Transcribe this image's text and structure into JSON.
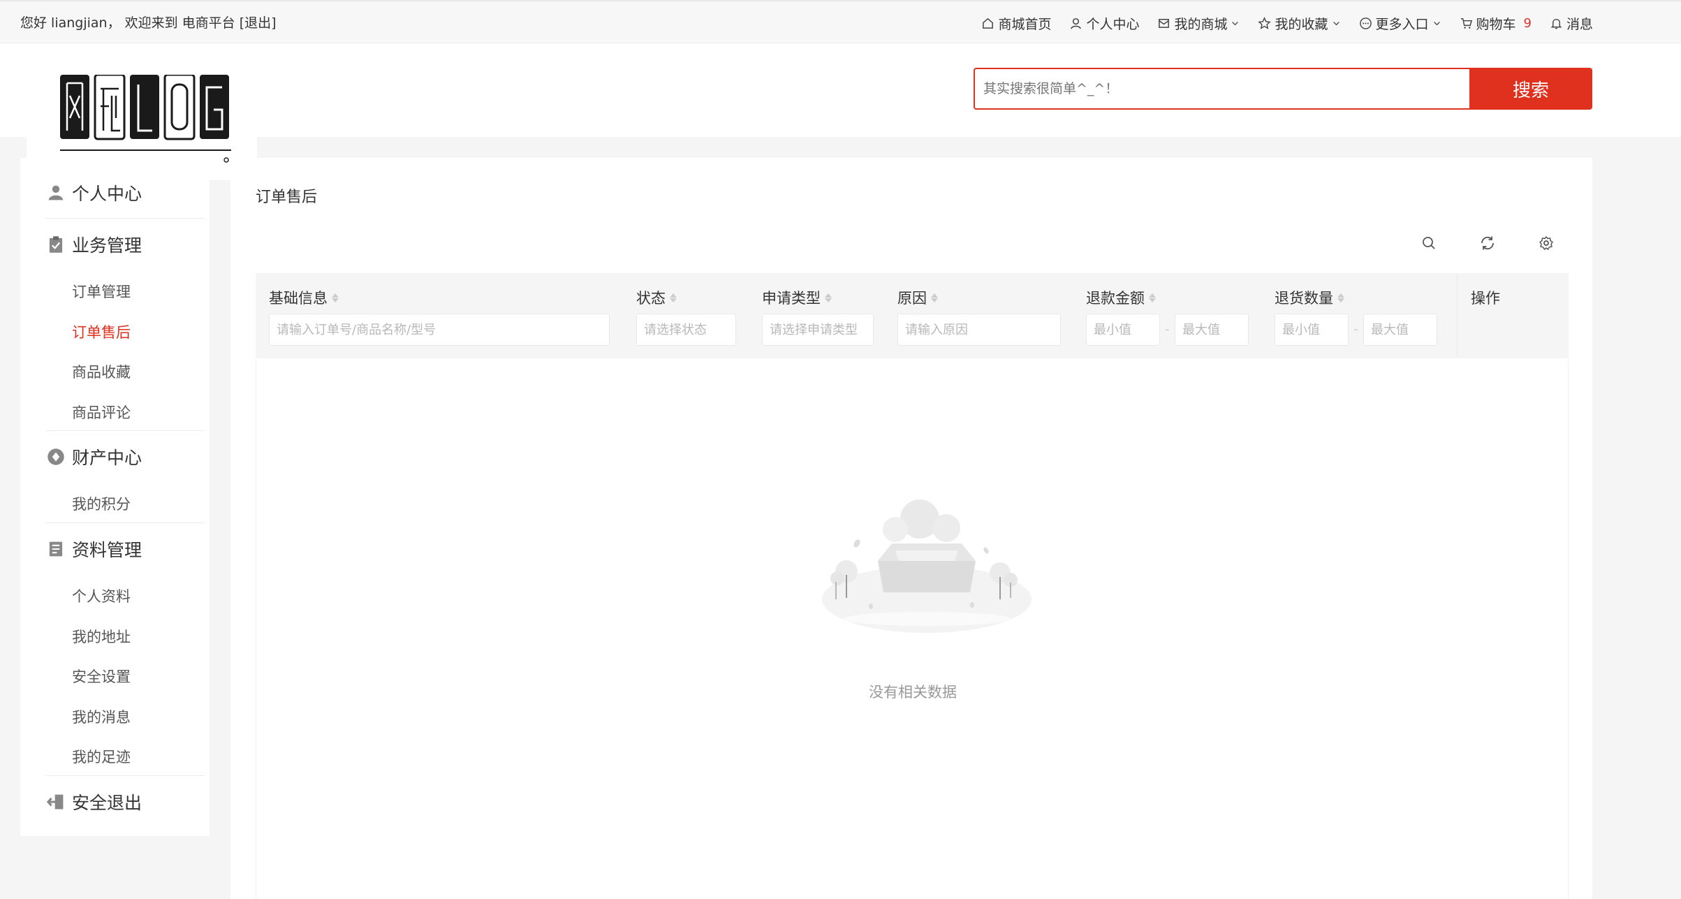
{
  "topbar": {
    "welcome": "您好 liangjian， 欢迎来到 电商平台 [退出]",
    "nav": [
      {
        "label": "商城首页",
        "icon": "home-icon"
      },
      {
        "label": "个人中心",
        "icon": "user-icon"
      },
      {
        "label": "我的商城",
        "icon": "mail-icon"
      },
      {
        "label": "我的收藏",
        "icon": "star-icon"
      },
      {
        "label": "更多入口",
        "icon": "more-icon"
      },
      {
        "label": "购物车",
        "icon": "cart-icon",
        "badge": "9"
      },
      {
        "label": "消息",
        "icon": "bell-icon"
      }
    ]
  },
  "search": {
    "placeholder": "其实搜索很简单^_^！",
    "button_label": "搜索"
  },
  "sidebar": {
    "groups": [
      {
        "label": "个人中心",
        "icon": "user-icon",
        "items": []
      },
      {
        "label": "业务管理",
        "icon": "clipboard-check-icon",
        "items": [
          "订单管理",
          "订单售后",
          "商品收藏",
          "商品评论"
        ]
      },
      {
        "label": "财产中心",
        "icon": "diamond-icon",
        "items": [
          "我的积分"
        ]
      },
      {
        "label": "资料管理",
        "icon": "document-icon",
        "items": [
          "个人资料",
          "我的地址",
          "安全设置",
          "我的消息",
          "我的足迹"
        ]
      },
      {
        "label": "安全退出",
        "icon": "logout-icon",
        "items": []
      }
    ],
    "active_item": "订单售后"
  },
  "main": {
    "title": "订单售后",
    "columns": [
      {
        "label": "基础信息",
        "filter_placeholder": "请输入订单号/商品名称/型号"
      },
      {
        "label": "状态",
        "filter_placeholder": "请选择状态"
      },
      {
        "label": "申请类型",
        "filter_placeholder": "请选择申请类型"
      },
      {
        "label": "原因",
        "filter_placeholder": "请输入原因"
      },
      {
        "label": "退款金额",
        "min_placeholder": "最小值",
        "max_placeholder": "最大值"
      },
      {
        "label": "退货数量",
        "min_placeholder": "最小值",
        "max_placeholder": "最大值"
      },
      {
        "label": "操作"
      }
    ],
    "empty_text": "没有相关数据"
  },
  "colors": {
    "accent": "#e0301e",
    "badge": "#e02e2e"
  }
}
